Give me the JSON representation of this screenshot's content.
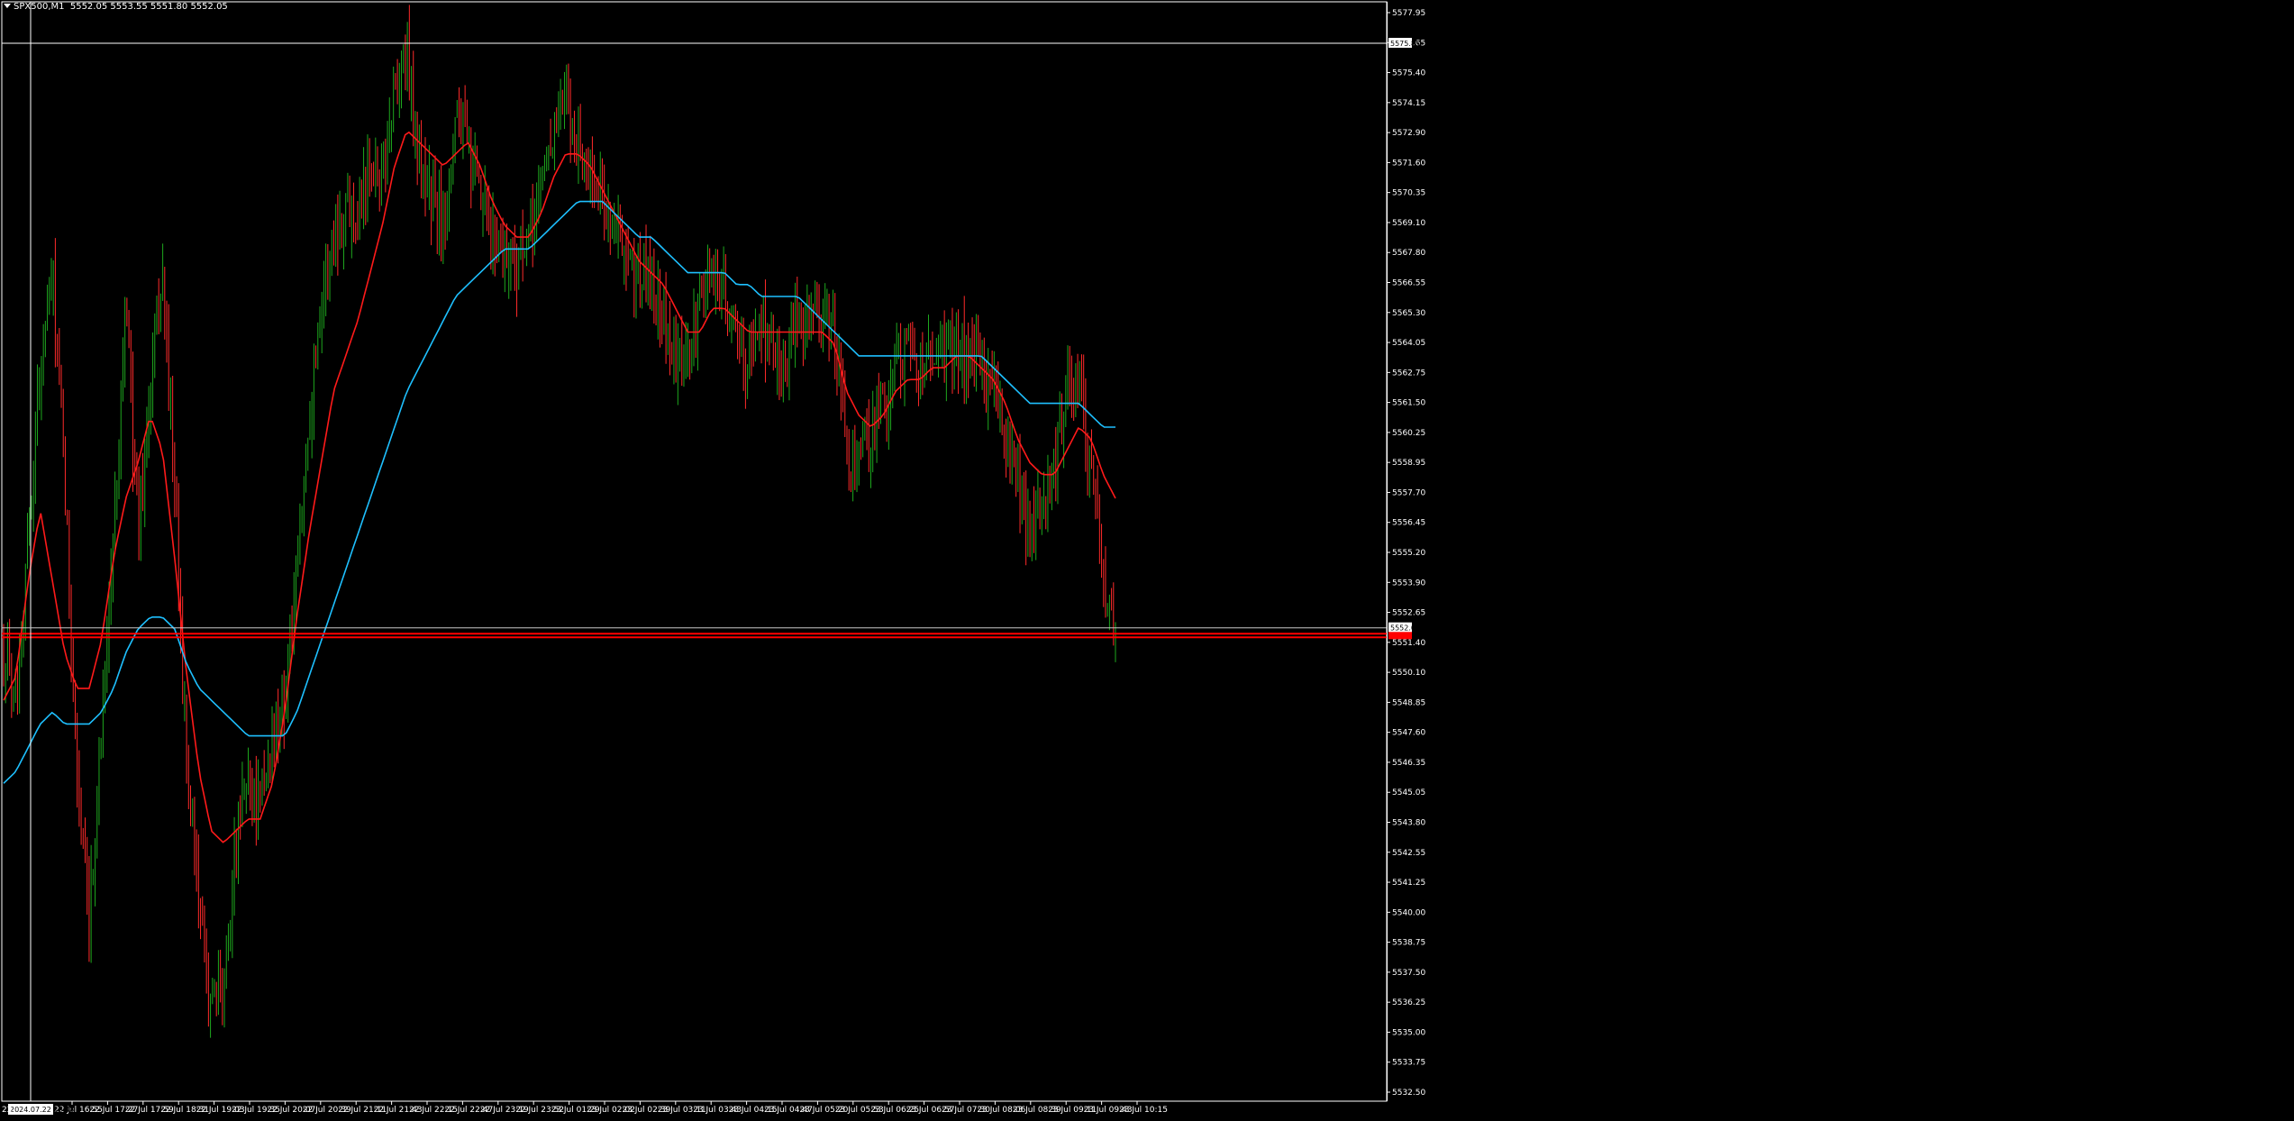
{
  "window": {
    "symbol_title": "SPX500,M1",
    "ohlc_text": "5552.05 5553.55 5551.80 5552.05"
  },
  "colors": {
    "background": "#000000",
    "grid": "#ffffff",
    "bull_candle": "#1ea81e",
    "bear_candle": "#ff2a2a",
    "ma_fast": "#ff1a1a",
    "ma_slow": "#1ec0ff",
    "price_line": "#ff0000"
  },
  "crosshair": {
    "price_label": "5575.85",
    "date_label": "2024.07.22 16:48"
  },
  "price_markers": {
    "current_price": "5552.05",
    "bid_level": 5551.8
  },
  "chart_data": {
    "type": "line",
    "title": "",
    "ylim": [
      5532.0,
      5578.0
    ],
    "y_ticks": [
      "5577.95",
      "5576.65",
      "5575.40",
      "5574.15",
      "5572.90",
      "5571.60",
      "5570.35",
      "5569.10",
      "5567.80",
      "5566.55",
      "5565.30",
      "5564.05",
      "5562.75",
      "5561.50",
      "5560.25",
      "5558.95",
      "5557.70",
      "5556.45",
      "5555.20",
      "5553.90",
      "5552.65",
      "5551.40",
      "5550.10",
      "5548.85",
      "5547.60",
      "5546.35",
      "5545.05",
      "5543.80",
      "5542.55",
      "5541.25",
      "5540.00",
      "5538.75",
      "5537.50",
      "5536.25",
      "5535.00",
      "5533.75",
      "5532.50"
    ],
    "x_ticks": [
      "22 Jul 16:55",
      "22 Jul 17:27",
      "22 Jul 17:59",
      "22 Jul 18:31",
      "22 Jul 19:03",
      "22 Jul 19:35",
      "22 Jul 20:07",
      "22 Jul 20:39",
      "22 Jul 21:11",
      "22 Jul 21:43",
      "22 Jul 22:15",
      "22 Jul 22:47",
      "22 Jul 23:19",
      "22 Jul 23:52",
      "23 Jul 01:29",
      "23 Jul 02:02",
      "23 Jul 02:39",
      "23 Jul 03:11",
      "23 Jul 03:43",
      "23 Jul 04:15",
      "23 Jul 04:47",
      "23 Jul 05:20",
      "23 Jul 05:53",
      "23 Jul 06:25",
      "23 Jul 06:57",
      "23 Jul 07:30",
      "23 Jul 08:06",
      "23 Jul 08:39",
      "23 Jul 09:11",
      "23 Jul 09:43",
      "23 Jul 10:15"
    ],
    "x_first_tick_prefix": "22",
    "price_path": [
      5551.0,
      5549.5,
      5556.0,
      5563.0,
      5567.0,
      5558.0,
      5546.0,
      5539.0,
      5548.0,
      5556.0,
      5566.0,
      5556.0,
      5562.0,
      5567.0,
      5558.0,
      5546.0,
      5540.0,
      5536.0,
      5537.0,
      5543.0,
      5546.0,
      5544.5,
      5547.0,
      5549.0,
      5554.0,
      5561.0,
      5566.0,
      5568.5,
      5570.0,
      5569.5,
      5572.0,
      5571.0,
      5575.0,
      5576.0,
      5572.0,
      5570.0,
      5569.0,
      5574.0,
      5572.0,
      5570.0,
      5568.5,
      5568.0,
      5567.5,
      5568.0,
      5571.0,
      5573.0,
      5574.0,
      5572.5,
      5571.0,
      5570.0,
      5569.0,
      5567.0,
      5567.0,
      5566.5,
      5565.5,
      5563.0,
      5563.5,
      5565.5,
      5567.5,
      5566.0,
      5564.0,
      5563.5,
      5565.0,
      5563.5,
      5563.0,
      5565.0,
      5565.5,
      5565.0,
      5564.5,
      5559.0,
      5559.5,
      5560.5,
      5561.5,
      5563.0,
      5564.0,
      5563.0,
      5563.5,
      5563.5,
      5564.0,
      5563.5,
      5563.0,
      5562.0,
      5560.0,
      5558.0,
      5556.0,
      5557.0,
      5558.5,
      5562.5,
      5562.0,
      5559.0,
      5554.0,
      5552.05
    ],
    "series": [
      {
        "key": "ma_fast",
        "values": [
          5549.0,
          5550.0,
          5554.0,
          5557.0,
          5554.0,
          5551.0,
          5549.5,
          5549.5,
          5551.5,
          5555.0,
          5557.5,
          5559.0,
          5561.0,
          5559.5,
          5555.0,
          5550.0,
          5546.0,
          5543.5,
          5543.0,
          5543.5,
          5544.0,
          5544.0,
          5545.5,
          5548.5,
          5552.5,
          5556.0,
          5559.0,
          5562.0,
          5563.5,
          5565.0,
          5567.0,
          5569.0,
          5571.5,
          5573.0,
          5572.5,
          5572.0,
          5571.5,
          5572.0,
          5572.5,
          5571.5,
          5570.0,
          5569.0,
          5568.5,
          5568.5,
          5569.5,
          5571.0,
          5572.0,
          5572.0,
          5571.5,
          5570.5,
          5569.5,
          5568.5,
          5567.5,
          5567.0,
          5566.5,
          5565.5,
          5564.5,
          5564.5,
          5565.5,
          5565.5,
          5565.0,
          5564.5,
          5564.5,
          5564.5,
          5564.5,
          5564.5,
          5564.5,
          5564.5,
          5564.0,
          5562.0,
          5561.0,
          5560.5,
          5561.0,
          5562.0,
          5562.5,
          5562.5,
          5563.0,
          5563.0,
          5563.5,
          5563.5,
          5563.0,
          5562.5,
          5561.5,
          5560.0,
          5559.0,
          5558.5,
          5558.5,
          5559.5,
          5560.5,
          5560.0,
          5558.5,
          5557.5
        ]
      },
      {
        "key": "ma_slow",
        "values": [
          5545.5,
          5546.0,
          5547.0,
          5548.0,
          5548.5,
          5548.0,
          5548.0,
          5548.0,
          5548.5,
          5549.5,
          5551.0,
          5552.0,
          5552.5,
          5552.5,
          5552.0,
          5550.5,
          5549.5,
          5549.0,
          5548.5,
          5548.0,
          5547.5,
          5547.5,
          5547.5,
          5547.5,
          5548.5,
          5550.0,
          5551.5,
          5553.0,
          5554.5,
          5556.0,
          5557.5,
          5559.0,
          5560.5,
          5562.0,
          5563.0,
          5564.0,
          5565.0,
          5566.0,
          5566.5,
          5567.0,
          5567.5,
          5568.0,
          5568.0,
          5568.0,
          5568.5,
          5569.0,
          5569.5,
          5570.0,
          5570.0,
          5570.0,
          5569.5,
          5569.0,
          5568.5,
          5568.5,
          5568.0,
          5567.5,
          5567.0,
          5567.0,
          5567.0,
          5567.0,
          5566.5,
          5566.5,
          5566.0,
          5566.0,
          5566.0,
          5566.0,
          5565.5,
          5565.0,
          5564.5,
          5564.0,
          5563.5,
          5563.5,
          5563.5,
          5563.5,
          5563.5,
          5563.5,
          5563.5,
          5563.5,
          5563.5,
          5563.5,
          5563.5,
          5563.0,
          5562.5,
          5562.0,
          5561.5,
          5561.5,
          5561.5,
          5561.5,
          5561.5,
          5561.0,
          5560.5,
          5560.5
        ]
      }
    ]
  }
}
